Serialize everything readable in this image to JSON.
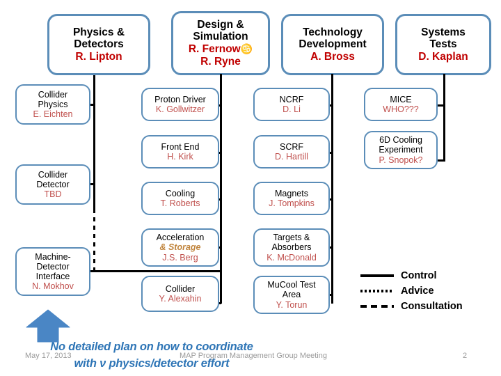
{
  "slide": {
    "page_number": "2",
    "footer_date": "May 17, 2013",
    "footer_title": "MAP Program Management Group Meeting"
  },
  "colors": {
    "box_border": "#5b8db8",
    "head_lead": "#c00000",
    "sub_lead": "#c0504d",
    "accent_orange": "#c0843c",
    "callout_blue": "#2e75b6",
    "arrow_blue": "#4a86c5",
    "line_black": "#000000"
  },
  "columns": [
    {
      "head": {
        "title_line_1": "Physics &",
        "title_line_2": "Detectors",
        "lead": "R. Lipton"
      },
      "children": [
        {
          "title_line_1": "Collider",
          "title_line_2": "Physics",
          "lead": "E. Eichten"
        },
        {
          "title_line_1": "Collider",
          "title_line_2": "Detector",
          "lead": "TBD"
        },
        {
          "title_line_1": "Machine-",
          "title_line_2": "Detector",
          "title_line_3": "Interface",
          "lead": "N. Mokhov"
        }
      ]
    },
    {
      "head": {
        "title_line_1": "Design &",
        "title_line_2": "Simulation",
        "lead": "R. Fernow",
        "lead_symbol": "♋",
        "lead_2": "R. Ryne"
      },
      "children": [
        {
          "title_line_1": "Proton Driver",
          "lead": "K. Gollwitzer"
        },
        {
          "title_line_1": "Front End",
          "lead": "H. Kirk"
        },
        {
          "title_line_1": "Cooling",
          "lead": "T. Roberts"
        },
        {
          "title_line_1": "Acceleration",
          "accent_line": "& Storage",
          "lead": "J.S. Berg"
        },
        {
          "title_line_1": "Collider",
          "lead": "Y. Alexahin"
        }
      ]
    },
    {
      "head": {
        "title_line_1": "Technology",
        "title_line_2": "Development",
        "lead": "A. Bross"
      },
      "children": [
        {
          "title_line_1": "NCRF",
          "lead": "D. Li"
        },
        {
          "title_line_1": "SCRF",
          "lead": "D. Hartill"
        },
        {
          "title_line_1": "Magnets",
          "lead": "J. Tompkins"
        },
        {
          "title_line_1": "Targets &",
          "title_line_2": "Absorbers",
          "lead": "K. McDonald"
        },
        {
          "title_line_1": "MuCool Test",
          "title_line_2": "Area",
          "lead": "Y. Torun"
        }
      ]
    },
    {
      "head": {
        "title_line_1": "Systems",
        "title_line_2": "Tests",
        "lead": "D. Kaplan"
      },
      "children": [
        {
          "title_line_1": "MICE",
          "lead": "WHO???"
        },
        {
          "title_line_1": "6D Cooling",
          "title_line_2": "Experiment",
          "lead": "P. Snopok?"
        }
      ]
    }
  ],
  "legend": {
    "items": [
      {
        "style": "solid",
        "label": "Control"
      },
      {
        "style": "dotted",
        "label": "Advice"
      },
      {
        "style": "dashed",
        "label": "Consultation"
      }
    ]
  },
  "callout": {
    "line_1": "No detailed plan on how to coordinate",
    "line_2": "with ν physics/detector effort"
  }
}
